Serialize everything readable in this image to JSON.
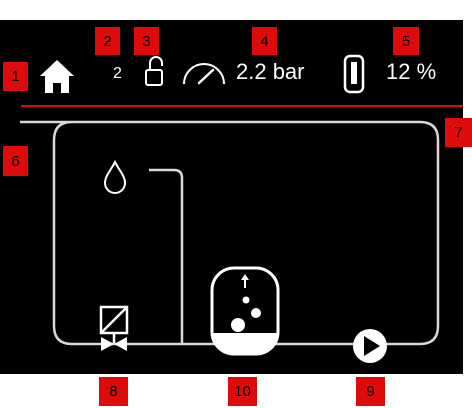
{
  "header": {
    "user_level": "2",
    "pressure": "2.2 bar",
    "fill_level": "12 %"
  },
  "callouts": {
    "home": "1",
    "user_level": "2",
    "lock": "3",
    "pressure": "4",
    "fill_level": "5",
    "system_area": "6",
    "divider": "7",
    "valve": "8",
    "pump": "9",
    "tank": "10"
  },
  "icons": {
    "home": "home-icon",
    "lock": "unlocked-padlock-icon",
    "gauge": "pressure-gauge-icon",
    "level": "fill-level-icon",
    "drop": "water-drop-icon",
    "valve": "solenoid-valve-icon",
    "tank": "tank-icon",
    "pump": "pump-icon"
  },
  "colors": {
    "screen_background": "#000000",
    "foreground": "#ffffff",
    "accent": "#dd0b0b",
    "pipe": "#d8d8d8"
  }
}
